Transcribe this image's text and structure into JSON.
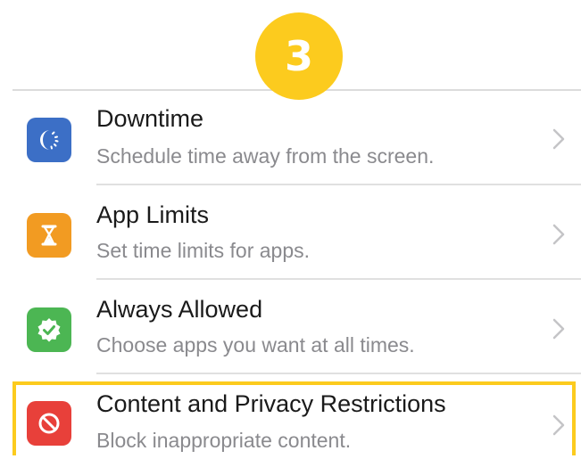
{
  "step_badge": {
    "number": "3",
    "color": "#FCCB1E"
  },
  "settings": {
    "items": [
      {
        "title": "Downtime",
        "subtitle": "Schedule time away from the screen.",
        "icon": "downtime-moon-icon",
        "icon_color": "#3C6FC6"
      },
      {
        "title": "App Limits",
        "subtitle": "Set time limits for apps.",
        "icon": "hourglass-icon",
        "icon_color": "#F29B22"
      },
      {
        "title": "Always Allowed",
        "subtitle": "Choose apps you want at all times.",
        "icon": "checkmark-badge-icon",
        "icon_color": "#4CB653"
      },
      {
        "title": "Content and Privacy Restrictions",
        "subtitle": "Block inappropriate content.",
        "icon": "no-entry-icon",
        "icon_color": "#E8403A",
        "highlighted": true
      }
    ]
  },
  "highlight_color": "#FCCB1E"
}
